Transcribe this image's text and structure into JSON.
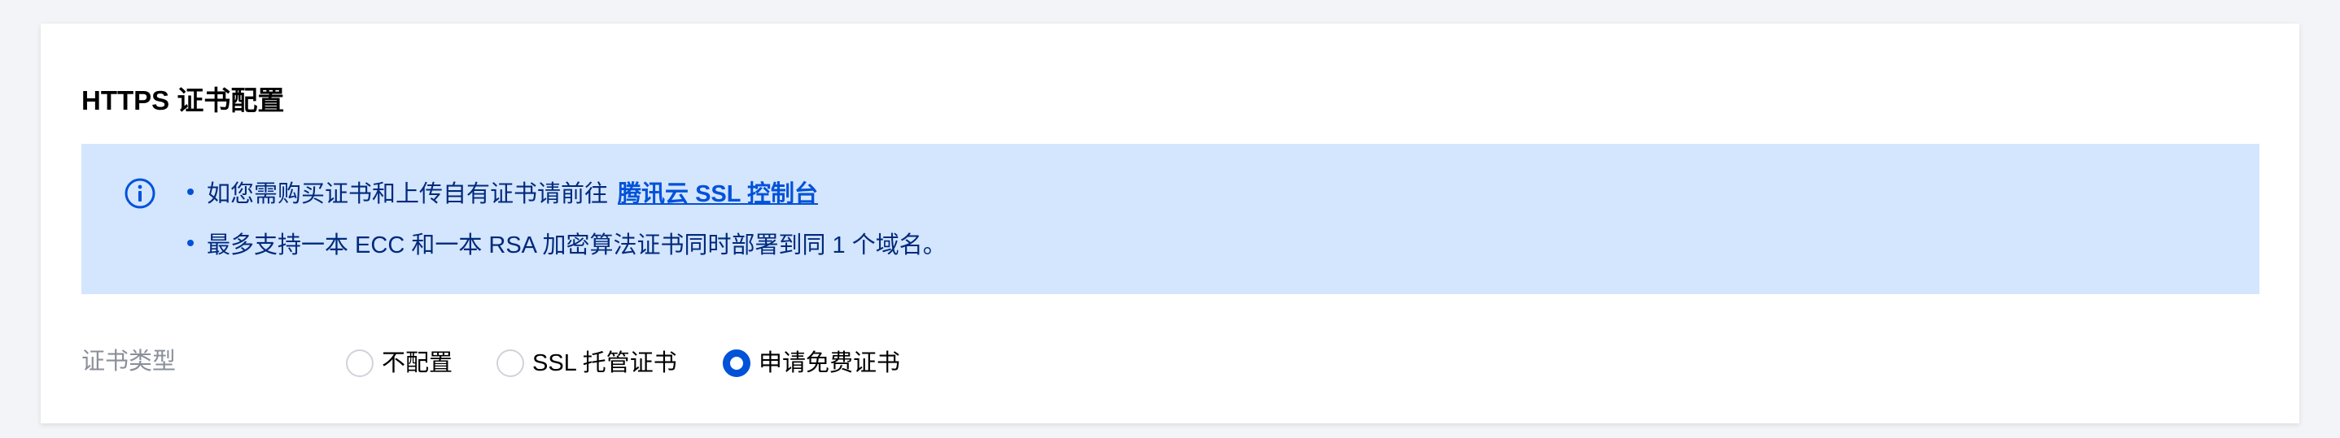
{
  "section": {
    "title": "HTTPS 证书配置"
  },
  "notice": {
    "icon": "info-icon",
    "accent_color": "#0052d9",
    "background_color": "#d4e5fe",
    "line1_text": "如您需购买证书和上传自有证书请前往",
    "line1_link": "腾讯云 SSL 控制台",
    "line2_text": "最多支持一本 ECC 和一本 RSA 加密算法证书同时部署到同 1 个域名。"
  },
  "form": {
    "cert_type_label": "证书类型",
    "options": [
      {
        "label": "不配置",
        "checked": false
      },
      {
        "label": "SSL 托管证书",
        "checked": false
      },
      {
        "label": "申请免费证书",
        "checked": true
      }
    ]
  }
}
